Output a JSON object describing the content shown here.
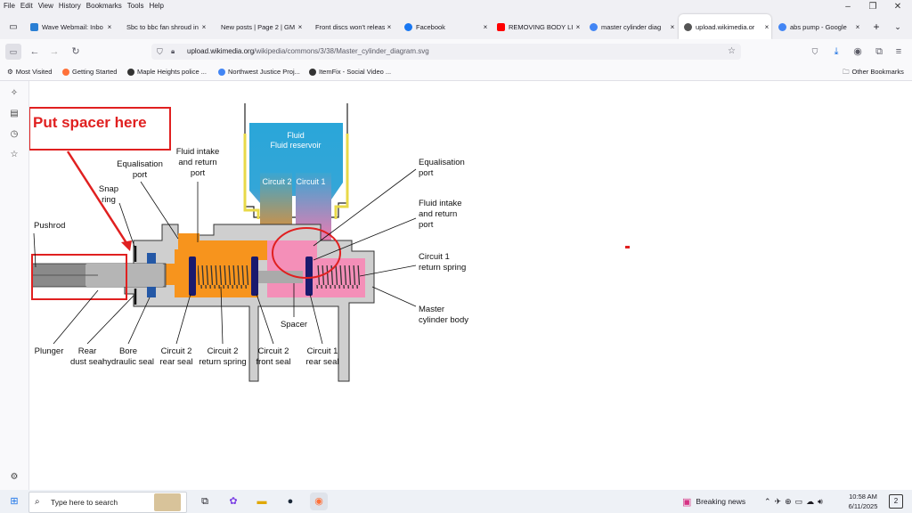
{
  "menu": [
    "File",
    "Edit",
    "View",
    "History",
    "Bookmarks",
    "Tools",
    "Help"
  ],
  "tabs": [
    {
      "title": "Wave Webmail: Inbo",
      "close": "×",
      "color": "#2a7fd4"
    },
    {
      "title": "Sbc to bbc fan shroud in",
      "close": "×",
      "color": "#888888"
    },
    {
      "title": "New posts | Page 2 | GM",
      "close": "×",
      "color": "#888888"
    },
    {
      "title": "Front discs won't release",
      "close": "×",
      "color": "#888888"
    },
    {
      "title": "Facebook",
      "close": "×",
      "color": "#1877f2"
    },
    {
      "title": "REMOVING BODY LI",
      "close": "×",
      "color": "#ff0000"
    },
    {
      "title": "master cylinder diag",
      "close": "×",
      "color": "#4285f4"
    },
    {
      "title": "upload.wikimedia.or",
      "close": "×",
      "color": "#555555"
    },
    {
      "title": "abs pump - Google",
      "close": "×",
      "color": "#4285f4"
    }
  ],
  "url": {
    "domain": "upload.wikimedia.org",
    "path": "/wikipedia/commons/3/38/Master_cylinder_diagram.svg"
  },
  "bookmarks": [
    {
      "label": "Most Visited"
    },
    {
      "label": "Getting Started"
    },
    {
      "label": "Maple Heights police ..."
    },
    {
      "label": "Northwest Justice Proj..."
    },
    {
      "label": "ItemFix - Social Video ..."
    }
  ],
  "other_bookmarks": "Other Bookmarks",
  "diagram": {
    "annotation": "Put spacer here",
    "reservoir": "Fluid reservoir",
    "circuit2": "Circuit 2",
    "circuit1": "Circuit 1",
    "labels": {
      "pushrod": "Pushrod",
      "snap_ring": "Snap ring",
      "equalisation_port_left": "Equalisation port",
      "fluid_intake_left": "Fluid intake and return port",
      "equalisation_port_right": "Equalisation port",
      "fluid_intake_right": "Fluid intake and return port",
      "circuit1_return_spring": "Circuit 1 return spring",
      "master_cylinder_body": "Master cylinder body",
      "spacer": "Spacer",
      "plunger": "Plunger",
      "rear_dust_seal": "Rear dust seal",
      "bore_hydraulic_seal": "Bore hydraulic seal",
      "circuit2_rear_seal": "Circuit 2 rear seal",
      "circuit2_return_spring": "Circuit 2 return spring",
      "circuit2_front_seal": "Circuit 2 front seal",
      "circuit1_rear_seal": "Circuit 1 rear seal"
    }
  },
  "taskbar": {
    "search_placeholder": "Type here to search",
    "news": "Breaking news",
    "time": "10:58 AM",
    "date": "6/11/2025",
    "notif_count": "2"
  }
}
